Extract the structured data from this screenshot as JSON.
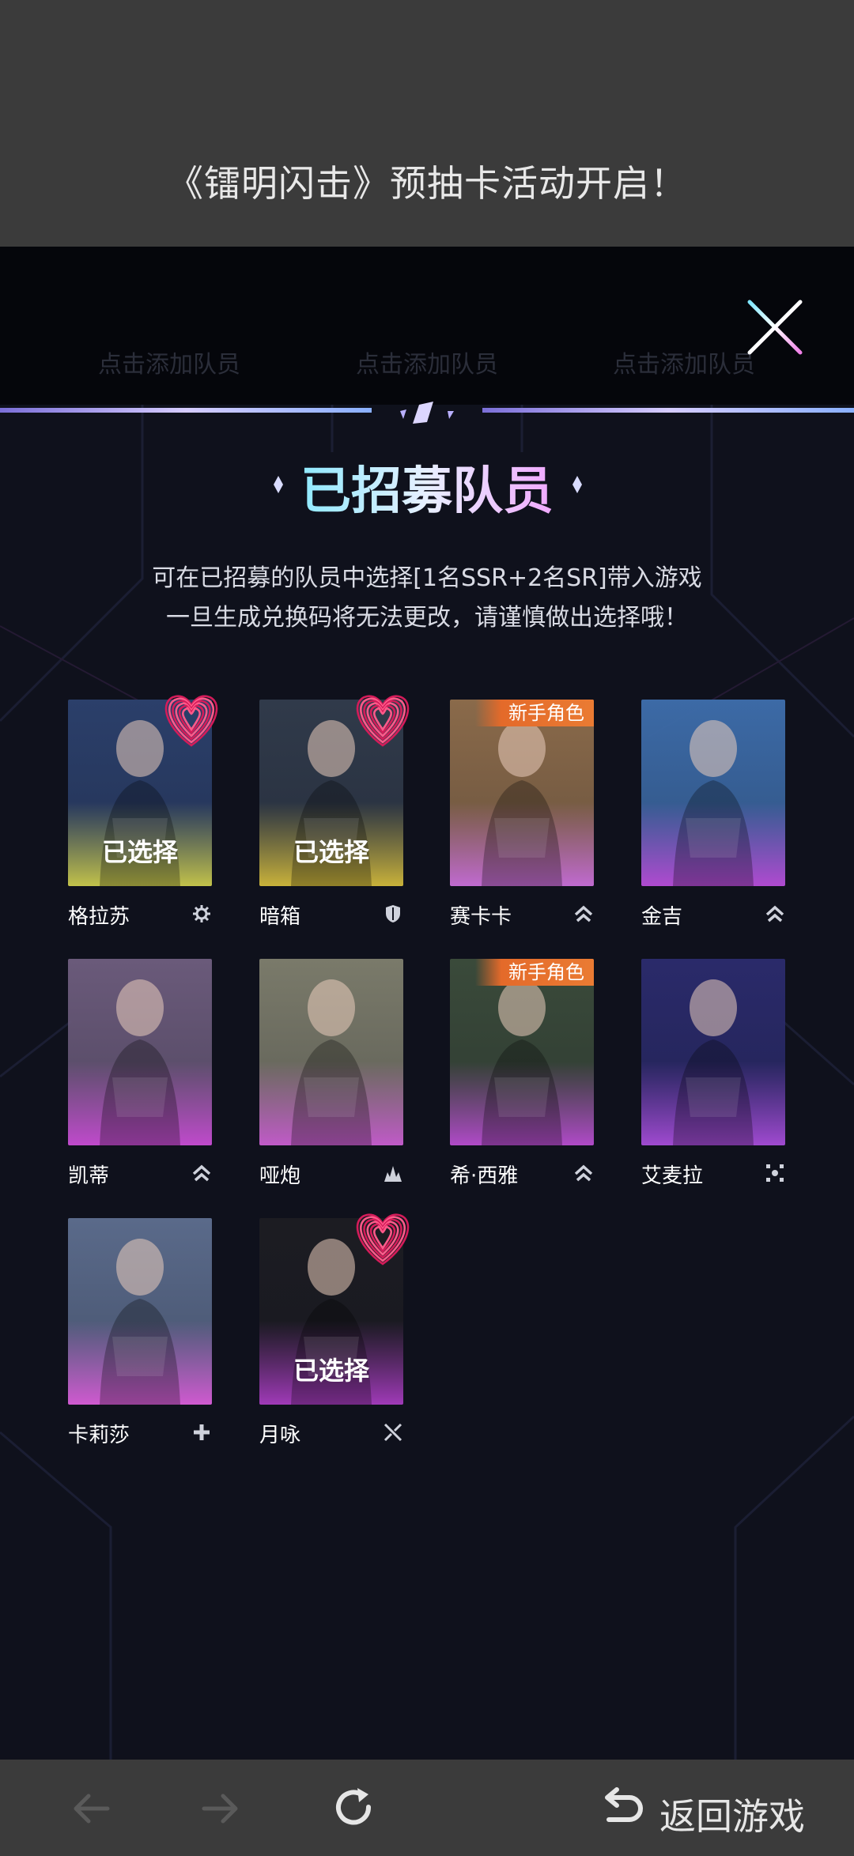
{
  "banner": {
    "title": "《镭明闪击》预抽卡活动开启！"
  },
  "slots": {
    "labels": [
      "点击添加队员",
      "点击添加队员",
      "点击添加队员"
    ]
  },
  "section": {
    "title": "已招募队员",
    "desc_line1": "可在已招募的队员中选择[1名SSR+2名SR]带入游戏",
    "desc_line2": "一旦生成兑换码将无法更改，请谨慎做出选择哦！"
  },
  "labels": {
    "selected": "已选择",
    "new_role": "新手角色"
  },
  "heroes": [
    {
      "name": "格拉苏",
      "selected": true,
      "new": false,
      "heart": true,
      "class_icon": "gear-class-icon",
      "palette": [
        "#2b3f6a",
        "#c2c24a"
      ]
    },
    {
      "name": "暗箱",
      "selected": true,
      "new": false,
      "heart": true,
      "class_icon": "shield-class-icon",
      "palette": [
        "#303a4a",
        "#c9b23a"
      ]
    },
    {
      "name": "赛卡卡",
      "selected": false,
      "new": true,
      "heart": false,
      "class_icon": "chevron-class-icon",
      "palette": [
        "#8a6a4a",
        "#c06ad0"
      ]
    },
    {
      "name": "金吉",
      "selected": false,
      "new": false,
      "heart": false,
      "class_icon": "chevron-class-icon",
      "palette": [
        "#3c6aa6",
        "#b04ad0"
      ]
    },
    {
      "name": "凯蒂",
      "selected": false,
      "new": false,
      "heart": false,
      "class_icon": "chevron-class-icon",
      "palette": [
        "#6a5a7a",
        "#c04acc"
      ]
    },
    {
      "name": "哑炮",
      "selected": false,
      "new": false,
      "heart": false,
      "class_icon": "burst-class-icon",
      "palette": [
        "#7a7a6a",
        "#c05ac8"
      ]
    },
    {
      "name": "希·西雅",
      "selected": false,
      "new": true,
      "heart": false,
      "class_icon": "chevron-class-icon",
      "palette": [
        "#3a4a3a",
        "#b04ac8"
      ]
    },
    {
      "name": "艾麦拉",
      "selected": false,
      "new": false,
      "heart": false,
      "class_icon": "dots-class-icon",
      "palette": [
        "#2a2a6a",
        "#a04ad0"
      ]
    },
    {
      "name": "卡莉莎",
      "selected": false,
      "new": false,
      "heart": false,
      "class_icon": "plus-class-icon",
      "palette": [
        "#5a6a8a",
        "#d05ad0"
      ]
    },
    {
      "name": "月咏",
      "selected": true,
      "new": false,
      "heart": true,
      "class_icon": "blades-class-icon",
      "palette": [
        "#1c1c22",
        "#a03ab8"
      ]
    }
  ],
  "bottom_bar": {
    "back_icon": "arrow-left-icon",
    "forward_icon": "arrow-right-icon",
    "refresh_icon": "refresh-icon",
    "return_icon": "return-icon",
    "return_label": "返回游戏"
  },
  "colors": {
    "modal_bg": "#0f111c",
    "accent_line": "#b7a6f2",
    "new_badge": "#e46a2a",
    "heart": "#e0306a"
  }
}
